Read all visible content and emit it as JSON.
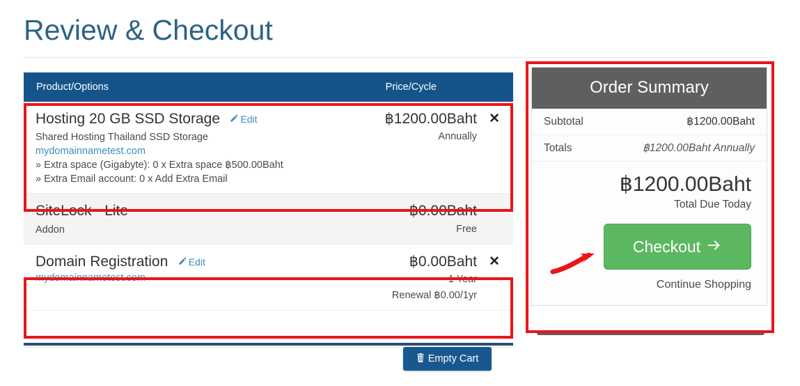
{
  "page": {
    "title": "Review & Checkout"
  },
  "cart_table": {
    "headers": {
      "product": "Product/Options",
      "price": "Price/Cycle"
    },
    "rows": [
      {
        "name": "Hosting 20 GB SSD Storage",
        "edit_label": "Edit",
        "edit_icon": "pencil-icon",
        "description": "Shared Hosting Thailand SSD Storage",
        "domain": "mydomainnametest.com",
        "config_lines": [
          "» Extra space (Gigabyte): 0 x Extra space ฿500.00Baht",
          "» Extra Email account: 0 x Add Extra Email"
        ],
        "price": "฿1200.00Baht",
        "cycle": "Annually",
        "remove_icon": "close-icon",
        "removable": true,
        "highlighted": true
      },
      {
        "name": "SiteLock - Lite",
        "description": "Addon",
        "price": "฿0.00Baht",
        "cycle": "Free",
        "removable": false,
        "highlighted": false
      },
      {
        "name": "Domain Registration",
        "edit_label": "Edit",
        "edit_icon": "pencil-icon",
        "domain": "mydomainnametest.com",
        "price": "฿0.00Baht",
        "cycle": "1 Year",
        "renewal": "Renewal ฿0.00/1yr",
        "remove_icon": "close-icon",
        "removable": true,
        "highlighted": true
      }
    ],
    "empty_cart_label": "Empty Cart",
    "empty_cart_icon": "trash-icon"
  },
  "order_summary": {
    "heading": "Order Summary",
    "lines": [
      {
        "label": "Subtotal",
        "value": "฿1200.00Baht",
        "italic": false
      },
      {
        "label": "Totals",
        "value": "฿1200.00Baht Annually",
        "italic": true
      }
    ],
    "total_amount": "฿1200.00Baht",
    "total_caption": "Total Due Today",
    "checkout_label": "Checkout",
    "checkout_icon": "arrow-right-icon",
    "continue_label": "Continue Shopping"
  },
  "annotations": {
    "highlight_color": "#e8151a",
    "arrow_icon": "red-arrow-icon",
    "boxes": [
      "hosting-row",
      "domain-row",
      "order-summary-panel"
    ]
  },
  "colors": {
    "table_header_bg": "#15548a",
    "summary_header_bg": "#5f5f5f",
    "checkout_green": "#5cb860",
    "title_blue": "#2c6383",
    "link_blue": "#3c8dbc",
    "annotation_red": "#e8151a"
  }
}
